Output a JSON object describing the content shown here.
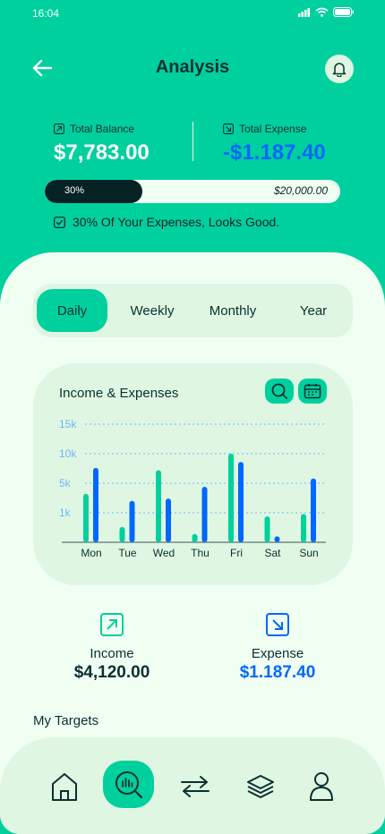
{
  "status_bar": {
    "time": "16:04"
  },
  "header": {
    "title": "Analysis"
  },
  "balances": {
    "total_balance_label": "Total Balance",
    "total_balance_value": "$7,783.00",
    "total_expense_label": "Total Expense",
    "total_expense_value": "-$1.187.40"
  },
  "progress": {
    "percent_label": "30%",
    "percent": 30,
    "goal": "$20,000.00",
    "note": "30% Of Your Expenses, Looks Good."
  },
  "tabs": [
    {
      "label": "Daily",
      "active": true
    },
    {
      "label": "Weekly",
      "active": false
    },
    {
      "label": "Monthly",
      "active": false
    },
    {
      "label": "Year",
      "active": false
    }
  ],
  "colors": {
    "brand": "#00D09E",
    "income_bar": "#00D09E",
    "expense_bar": "#0068FF",
    "dark": "#093030",
    "panel": "#F1FFF3",
    "card": "#DFF7E2"
  },
  "chart_data": {
    "type": "bar",
    "title": "Income & Expenses",
    "categories": [
      "Mon",
      "Tue",
      "Wed",
      "Thu",
      "Fri",
      "Sat",
      "Sun"
    ],
    "y_ticks": [
      "1k",
      "5k",
      "10k",
      "15k"
    ],
    "y_tick_values": [
      2500,
      5000,
      7500,
      10000
    ],
    "ylim": [
      0,
      10000
    ],
    "series": [
      {
        "values": [
          4100,
          1300,
          6100,
          700,
          7500,
          2200,
          2400
        ],
        "color": "#00D09E"
      },
      {
        "values": [
          6300,
          3500,
          3700,
          4700,
          6800,
          500,
          5400
        ],
        "color": "#0068FF"
      }
    ],
    "grid": true
  },
  "summary": {
    "income_label": "Income",
    "income_value": "$4,120.00",
    "expense_label": "Expense",
    "expense_value": "$1.187.40"
  },
  "targets": {
    "title": "My Targets"
  },
  "nav": {
    "items": [
      {
        "icon": "home-icon",
        "active": false
      },
      {
        "icon": "analysis-icon",
        "active": true
      },
      {
        "icon": "transactions-icon",
        "active": false
      },
      {
        "icon": "layers-icon",
        "active": false
      },
      {
        "icon": "profile-icon",
        "active": false
      }
    ]
  }
}
